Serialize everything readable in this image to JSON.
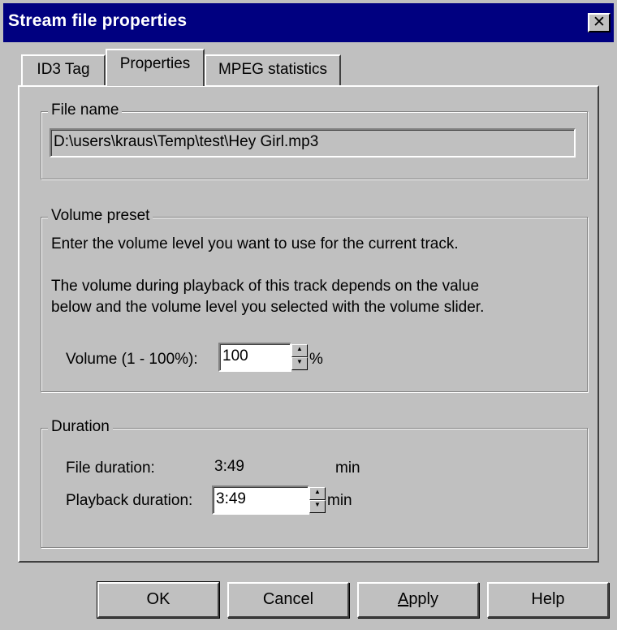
{
  "window": {
    "title": "Stream file properties",
    "close_glyph": "✕"
  },
  "tabs": [
    {
      "label": "ID3 Tag",
      "active": false
    },
    {
      "label": "Properties",
      "active": true
    },
    {
      "label": "MPEG statistics",
      "active": false
    }
  ],
  "file_name": {
    "legend": "File name",
    "value": "D:\\users\\kraus\\Temp\\test\\Hey Girl.mp3"
  },
  "volume_preset": {
    "legend": "Volume preset",
    "instruction": "Enter the volume level you want to use for the current track.",
    "note_line1": "The volume during playback of this track depends on the value",
    "note_line2": "below and the volume level you selected with the volume slider.",
    "volume_label": "Volume (1 - 100%):",
    "volume_value": "100",
    "volume_unit": "%"
  },
  "duration": {
    "legend": "Duration",
    "file_duration_label": "File duration:",
    "file_duration_value": "3:49",
    "file_duration_unit": "min",
    "playback_duration_label": "Playback duration:",
    "playback_duration_value": "3:49",
    "playback_duration_unit": "min"
  },
  "buttons": {
    "ok": "OK",
    "cancel": "Cancel",
    "apply_first": "A",
    "apply_rest": "pply",
    "help": "Help"
  },
  "colors": {
    "titlebar": "#000080",
    "face": "#c0c0c0"
  },
  "icons": {
    "close": "close-icon",
    "spin_up": "spin-up-arrow-icon",
    "spin_down": "spin-down-arrow-icon"
  }
}
